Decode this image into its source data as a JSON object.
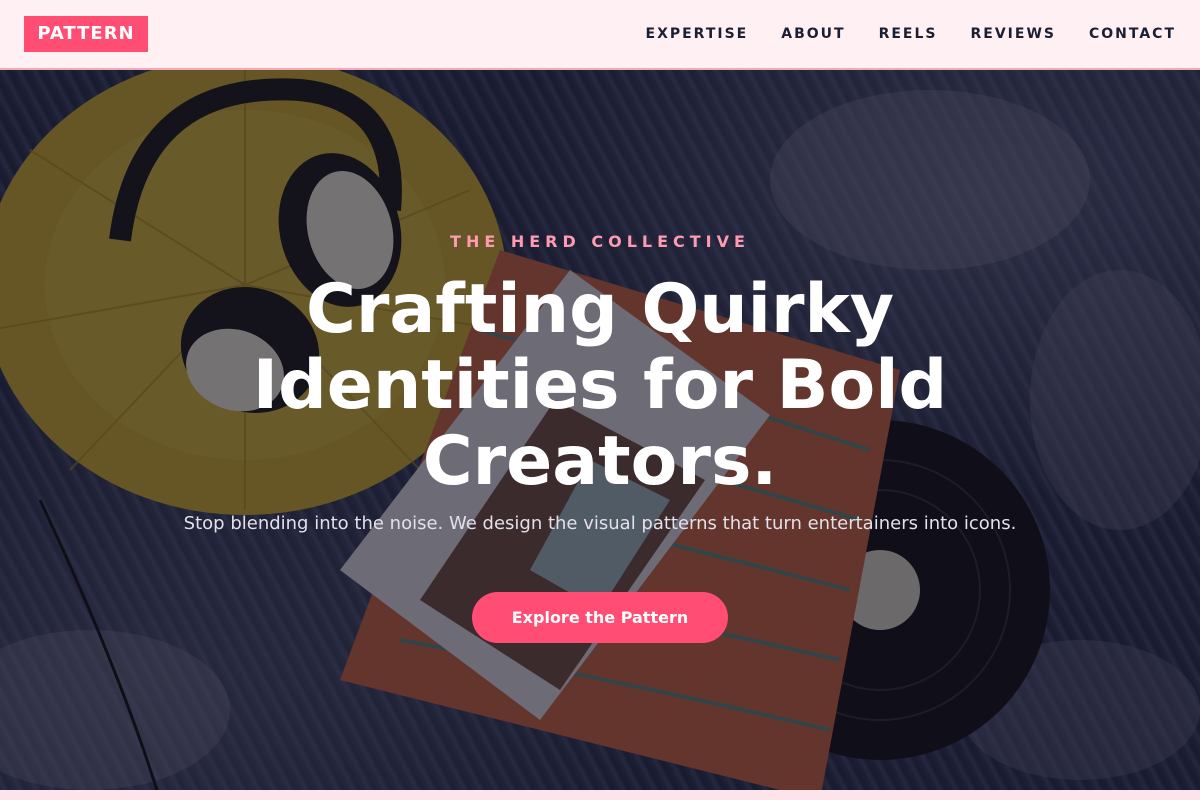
{
  "brand": {
    "logo_text": "PATTERN",
    "accent_color": "#ff4d73",
    "nav_bg": "#fff0f3"
  },
  "nav": {
    "links": [
      {
        "label": "EXPERTISE"
      },
      {
        "label": "ABOUT"
      },
      {
        "label": "REELS"
      },
      {
        "label": "REVIEWS"
      },
      {
        "label": "CONTACT"
      }
    ]
  },
  "hero": {
    "eyebrow": "THE HERD COLLECTIVE",
    "headline_lines": [
      "Crafting Quirky",
      "Identities for Bold",
      "Creators."
    ],
    "subtext": "Stop blending into the noise. We design the visual patterns that turn entertainers into icons.",
    "cta_label": "Explore the Pattern",
    "background_image_subject": "headphones on yellow pillow, magazine and vinyl record on patterned rug"
  }
}
